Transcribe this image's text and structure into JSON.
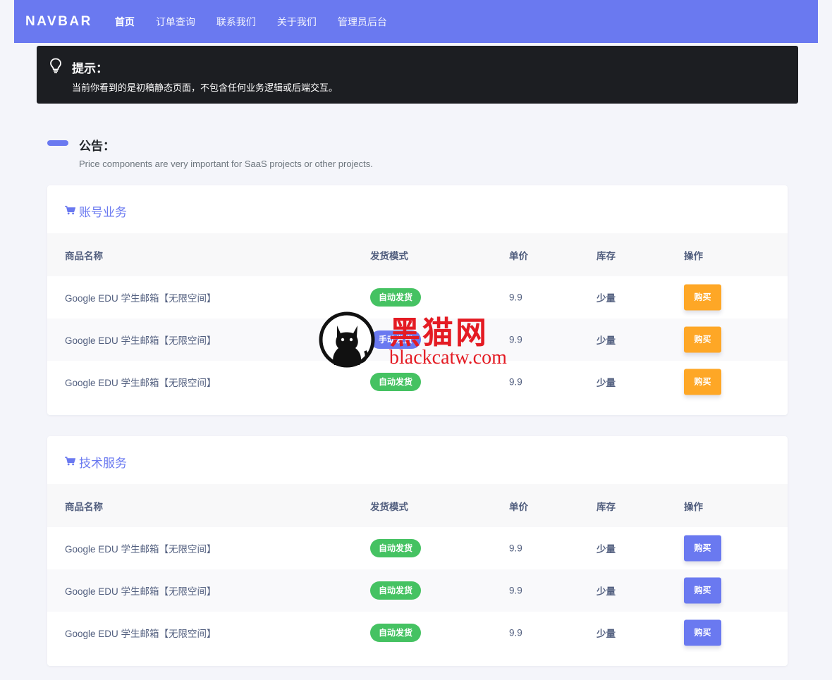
{
  "navbar": {
    "brand": "NAVBAR",
    "items": [
      {
        "label": "首页",
        "active": true
      },
      {
        "label": "订单查询",
        "active": false
      },
      {
        "label": "联系我们",
        "active": false
      },
      {
        "label": "关于我们",
        "active": false
      },
      {
        "label": "管理员后台",
        "active": false
      }
    ]
  },
  "tip": {
    "icon": "lightbulb-icon",
    "title": "提示：",
    "text": "当前你看到的是初稿静态页面，不包含任何业务逻辑或后端交互。"
  },
  "notice": {
    "title": "公告：",
    "subtitle": "Price components are very important for SaaS projects or other projects."
  },
  "columns": {
    "name": "商品名称",
    "mode": "发货模式",
    "price": "单价",
    "stock": "库存",
    "op": "操作"
  },
  "sections": [
    {
      "title": "账号业务",
      "icon": "cart-icon",
      "button_color": "#fea726",
      "rows": [
        {
          "name": "Google EDU 学生邮箱【无限空间】",
          "mode": "自动发货",
          "mode_type": "auto",
          "price": "9.9",
          "stock": "少量",
          "button": "购买"
        },
        {
          "name": "Google EDU 学生邮箱【无限空间】",
          "mode": "手动发货",
          "mode_type": "manual",
          "price": "9.9",
          "stock": "少量",
          "button": "购买"
        },
        {
          "name": "Google EDU 学生邮箱【无限空间】",
          "mode": "自动发货",
          "mode_type": "auto",
          "price": "9.9",
          "stock": "少量",
          "button": "购买"
        }
      ]
    },
    {
      "title": "技术服务",
      "icon": "cart-icon",
      "button_color": "#6a79f0",
      "rows": [
        {
          "name": "Google EDU 学生邮箱【无限空间】",
          "mode": "自动发货",
          "mode_type": "auto",
          "price": "9.9",
          "stock": "少量",
          "button": "购买"
        },
        {
          "name": "Google EDU 学生邮箱【无限空间】",
          "mode": "自动发货",
          "mode_type": "auto",
          "price": "9.9",
          "stock": "少量",
          "button": "购买"
        },
        {
          "name": "Google EDU 学生邮箱【无限空间】",
          "mode": "自动发货",
          "mode_type": "auto",
          "price": "9.9",
          "stock": "少量",
          "button": "购买"
        }
      ]
    }
  ],
  "watermark": {
    "title": "黑猫网",
    "url": "blackcatw.com"
  },
  "colors": {
    "primary": "#6a79f0",
    "success": "#45c262",
    "warning": "#fea726",
    "dark": "#1c1e22"
  }
}
